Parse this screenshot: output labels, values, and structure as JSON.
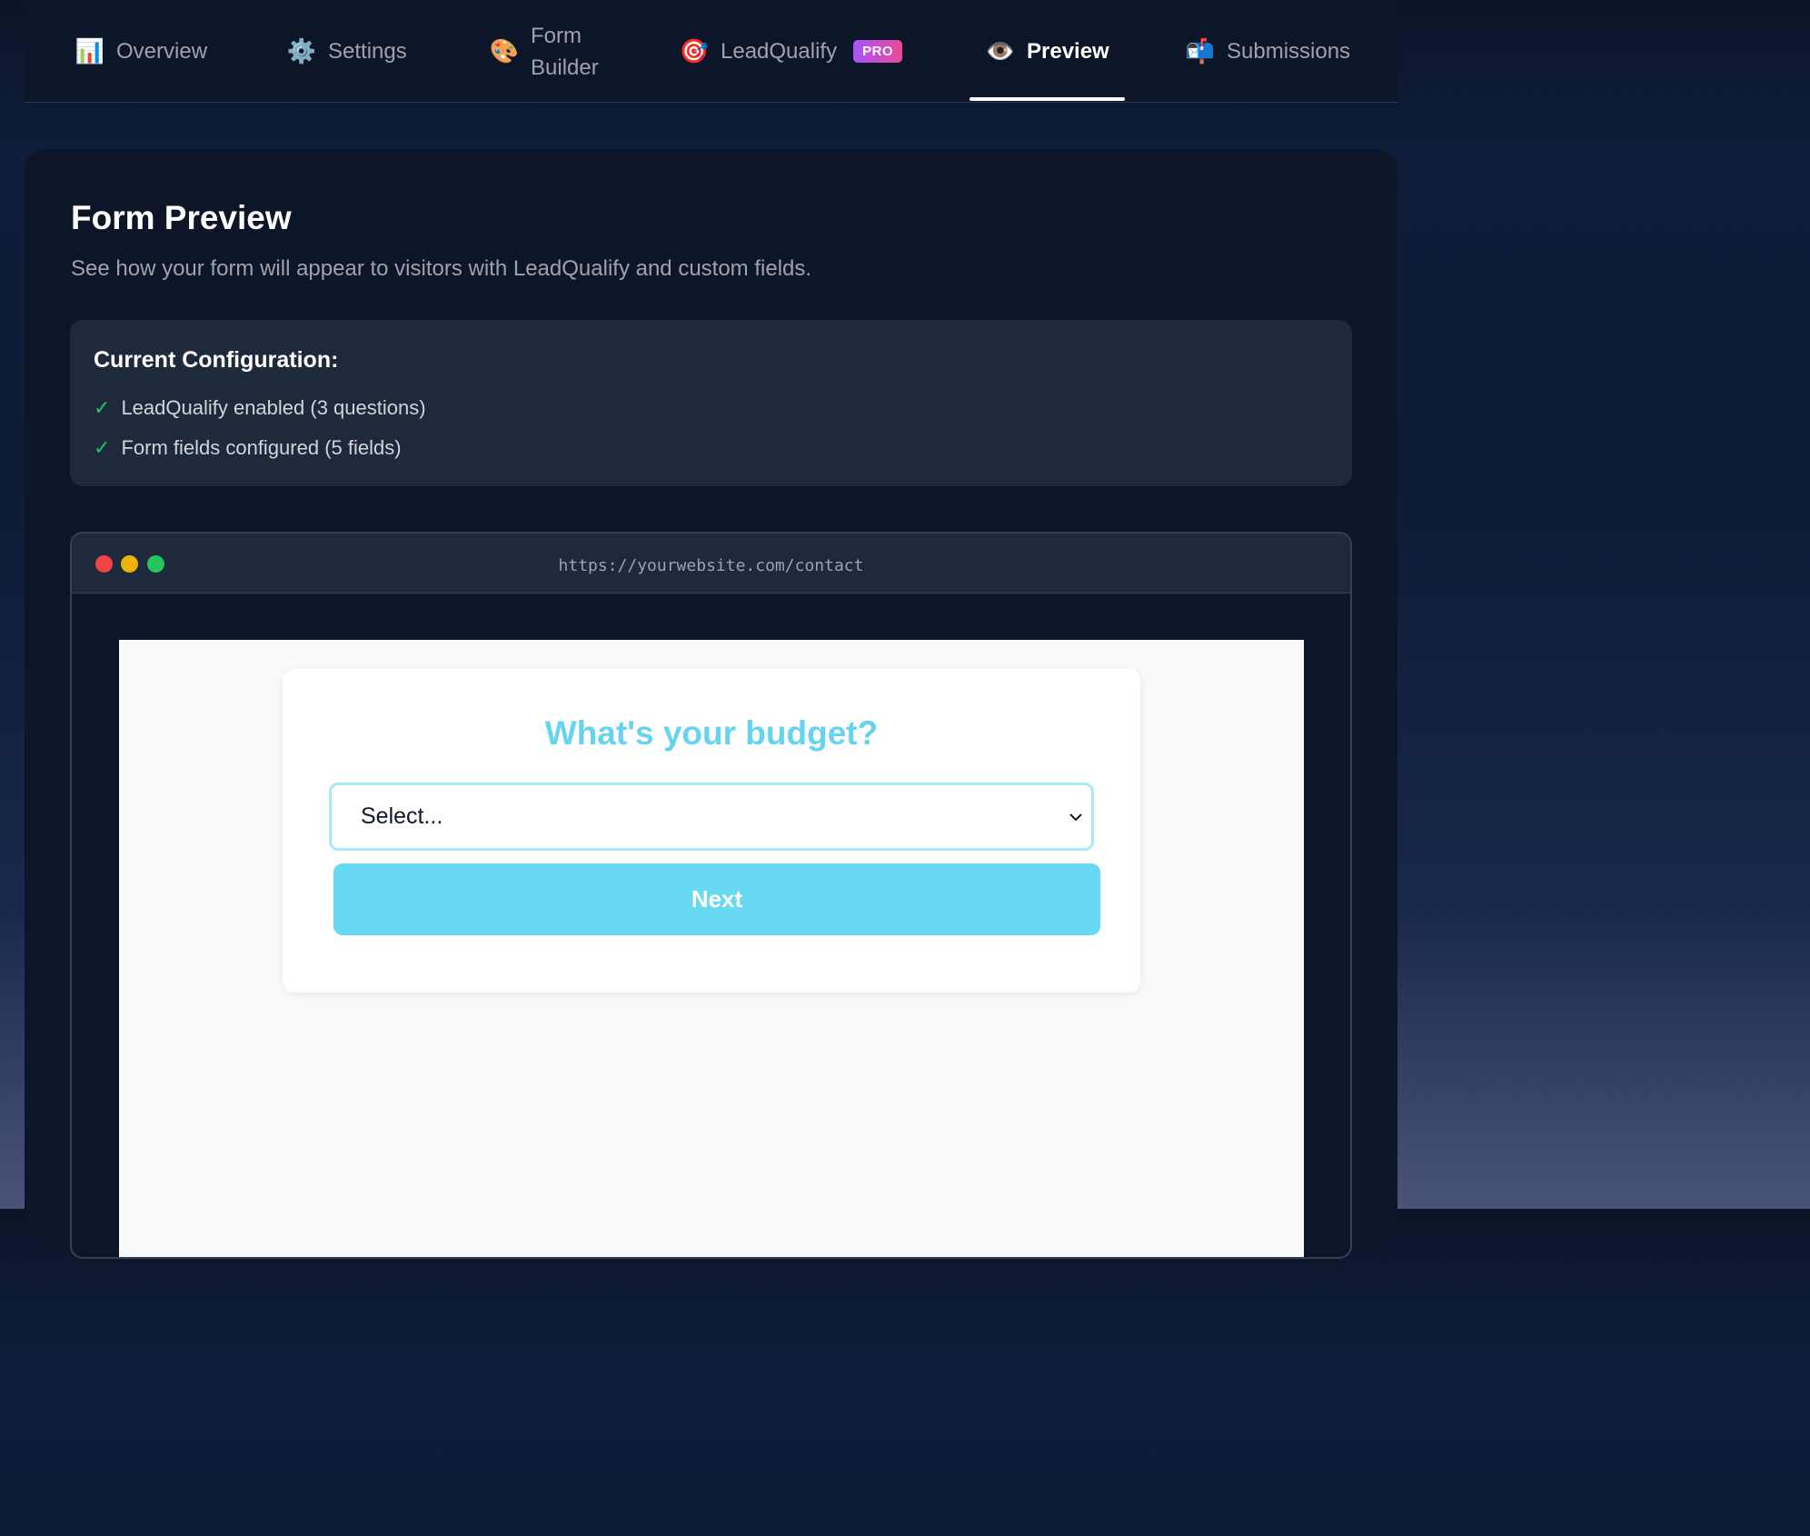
{
  "tabs": [
    {
      "icon": "📊",
      "label": "Overview"
    },
    {
      "icon": "⚙️",
      "label": "Settings"
    },
    {
      "icon": "🎨",
      "label_line1": "Form",
      "label_line2": "Builder"
    },
    {
      "icon": "🎯",
      "label": "LeadQualify",
      "badge": "PRO"
    },
    {
      "icon": "👁️",
      "label": "Preview"
    },
    {
      "icon": "📬",
      "label": "Submissions"
    }
  ],
  "active_tab": "Preview",
  "page": {
    "title": "Form Preview",
    "subtitle": "See how your form will appear to visitors with LeadQualify and custom fields."
  },
  "config": {
    "title": "Current Configuration:",
    "items": [
      "LeadQualify enabled (3 questions)",
      "Form fields configured (5 fields)"
    ],
    "check_glyph": "✓"
  },
  "browser": {
    "url": "https://yourwebsite.com/contact"
  },
  "form": {
    "question": "What's your budget?",
    "select_value": "Select...",
    "next_label": "Next"
  },
  "colors": {
    "accent": "#67d9f2",
    "check": "#22c55e",
    "pro_badge": "#c04cf0"
  }
}
